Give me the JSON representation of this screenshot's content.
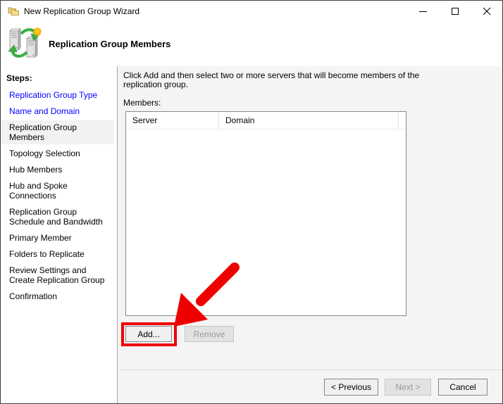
{
  "window": {
    "title": "New Replication Group Wizard",
    "icons": {
      "titlebar": "folders-icon",
      "minimize": "minimize-icon",
      "maximize": "maximize-icon",
      "close": "close-icon",
      "header": "replication-servers-icon"
    }
  },
  "header": {
    "title": "Replication Group Members"
  },
  "sidebar": {
    "title": "Steps:",
    "items": [
      {
        "label": "Replication Group Type",
        "state": "completed"
      },
      {
        "label": "Name and Domain",
        "state": "completed"
      },
      {
        "label": "Replication Group Members",
        "state": "current"
      },
      {
        "label": "Topology Selection",
        "state": "upcoming"
      },
      {
        "label": "Hub Members",
        "state": "upcoming"
      },
      {
        "label": "Hub and Spoke Connections",
        "state": "upcoming"
      },
      {
        "label": "Replication Group Schedule and Bandwidth",
        "state": "upcoming"
      },
      {
        "label": "Primary Member",
        "state": "upcoming"
      },
      {
        "label": "Folders to Replicate",
        "state": "upcoming"
      },
      {
        "label": "Review Settings and Create Replication Group",
        "state": "upcoming"
      },
      {
        "label": "Confirmation",
        "state": "upcoming"
      }
    ],
    "link_color": "#0000ff"
  },
  "content": {
    "instruction_lines": [
      "Click Add and then select two or more servers that will become members of the",
      "replication group."
    ],
    "members_label": "Members:",
    "table": {
      "columns": [
        "Server",
        "Domain"
      ],
      "rows": []
    },
    "add_button": "Add...",
    "remove_button": "Remove",
    "remove_enabled": false
  },
  "footer": {
    "previous": "< Previous",
    "next": "Next >",
    "next_enabled": false,
    "cancel": "Cancel"
  },
  "annotation": {
    "color": "#ee0000"
  }
}
